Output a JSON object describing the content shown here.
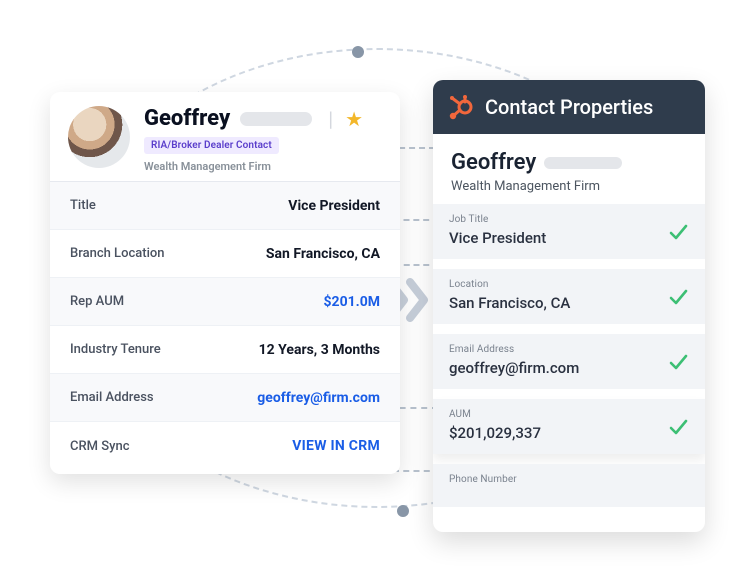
{
  "left": {
    "name": "Geoffrey",
    "tag": "RIA/Broker Dealer Contact",
    "firm": "Wealth Management Firm",
    "rows": [
      {
        "label": "Title",
        "value": "Vice President"
      },
      {
        "label": "Branch Location",
        "value": "San Francisco, CA"
      },
      {
        "label": "Rep AUM",
        "value": "$201.0M"
      },
      {
        "label": "Industry Tenure",
        "value": "12 Years, 3 Months"
      },
      {
        "label": "Email Address",
        "value": "geoffrey@firm.com"
      },
      {
        "label": "CRM Sync",
        "value": "VIEW IN CRM"
      }
    ]
  },
  "right": {
    "header": "Contact Properties",
    "name": "Geoffrey",
    "firm": "Wealth Management Firm",
    "props": [
      {
        "label": "Job Title",
        "value": "Vice President"
      },
      {
        "label": "Location",
        "value": "San Francisco, CA"
      },
      {
        "label": "Email Address",
        "value": "geoffrey@firm.com"
      },
      {
        "label": "AUM",
        "value": "$201,029,337"
      },
      {
        "label": "Phone Number",
        "value": ""
      }
    ]
  }
}
